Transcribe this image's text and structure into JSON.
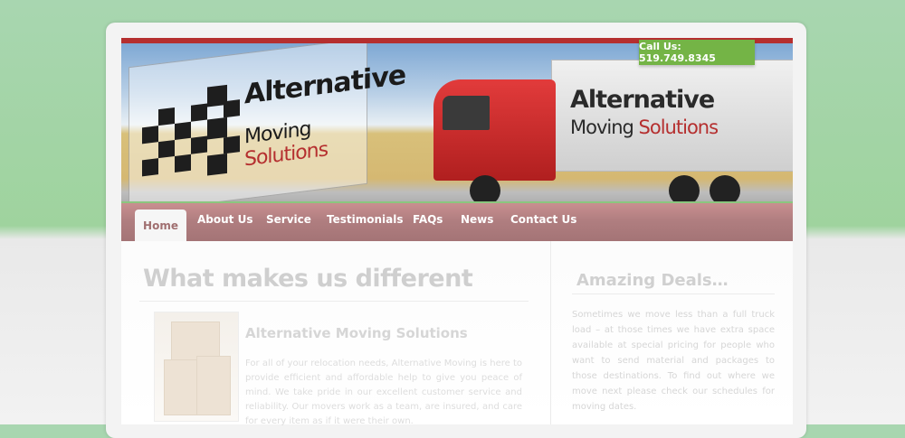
{
  "header": {
    "logo_line1": "Alternative",
    "logo_line2a": "Moving ",
    "logo_line2b": "Solutions",
    "call_us": "Call Us: 519.749.8345"
  },
  "nav": {
    "items": [
      "Home",
      "About Us",
      "Service",
      "Testimonials",
      "FAQs",
      "News",
      "Contact Us"
    ],
    "active": "Home"
  },
  "main": {
    "heading": "What makes us different",
    "subheading": "Alternative Moving Solutions",
    "body": "For all of your relocation needs, Alternative Moving is here to provide efficient and affordable help to give you peace of mind. We take pride in our excellent customer service and reliability. Our movers work as a team, are insured, and care for every item as if it were their own."
  },
  "sidebar": {
    "heading": "Amazing Deals…",
    "body": "Sometimes we move less than a full truck load – at those times we have extra space available at special pricing for people who want to send material and packages to those destinations. To find out where we move next please check our schedules for moving dates."
  },
  "colors": {
    "accent_green": "#74b446",
    "nav_mauve": "#b07e80",
    "brand_red": "#b52f2f"
  }
}
